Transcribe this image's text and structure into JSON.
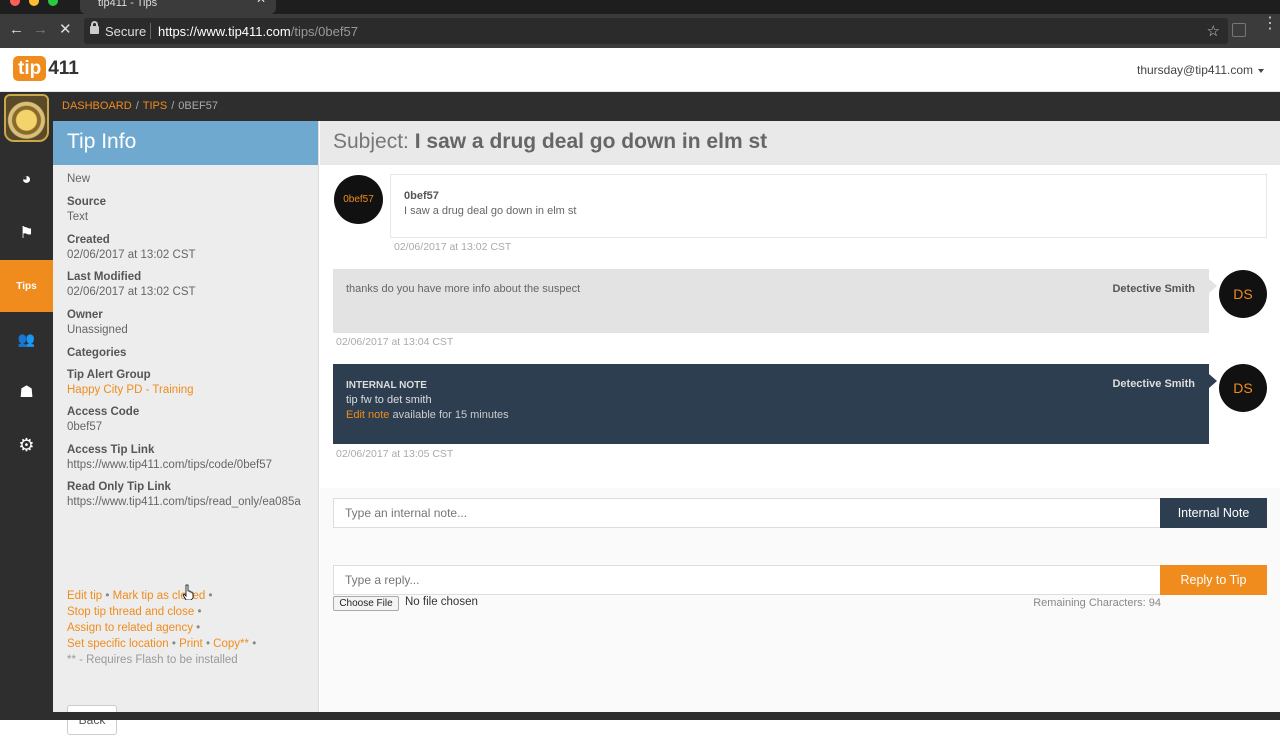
{
  "browser": {
    "tab_title": "tip411 - Tips",
    "tab_close": "✕",
    "secure_label": "Secure",
    "url_host": "https://www.tip411.com",
    "url_path": "/tips/0bef57",
    "back_glyph": "←",
    "forward_glyph": "→",
    "stop_glyph": "✕",
    "star_glyph": "☆",
    "menu_glyph": "⋮",
    "traffic_colors": [
      "#ff5f57",
      "#febc2e",
      "#28c840"
    ]
  },
  "header": {
    "logo_tip": "tip",
    "logo_num": "411",
    "user_email": "thursday@tip411.com"
  },
  "sidebar": {
    "items": [
      {
        "icon": "dashboard-icon",
        "glyph": "◕"
      },
      {
        "icon": "flag-icon",
        "glyph": "⚑"
      },
      {
        "icon": "tips-icon",
        "label": "Tips",
        "active": true
      },
      {
        "icon": "users-icon",
        "glyph": "👥"
      },
      {
        "icon": "sitemap-icon",
        "glyph": "☗"
      },
      {
        "icon": "gear-icon",
        "glyph": "⚙"
      }
    ],
    "accent": "#f08c1d"
  },
  "breadcrumb": {
    "dashboard": "DASHBOARD",
    "tips": "TIPS",
    "sep": "/",
    "current": "0BEF57"
  },
  "tip_info": {
    "title": "Tip Info",
    "status": "New",
    "source_label": "Source",
    "source_value": "Text",
    "created_label": "Created",
    "created_value": "02/06/2017 at 13:02 CST",
    "modified_label": "Last Modified",
    "modified_value": "02/06/2017 at 13:02 CST",
    "owner_label": "Owner",
    "owner_value": "Unassigned",
    "categories_label": "Categories",
    "alert_group_label": "Tip Alert Group",
    "alert_group_value": "Happy City PD - Training",
    "access_code_label": "Access Code",
    "access_code_value": "0bef57",
    "access_link_label": "Access Tip Link",
    "access_link_value": "https://www.tip411.com/tips/code/0bef57",
    "readonly_link_label": "Read Only Tip Link",
    "readonly_link_value": "https://www.tip411.com/tips/read_only/ea085a",
    "actions": {
      "edit": "Edit tip",
      "close": "Mark tip as closed",
      "stop": "Stop tip thread and close",
      "assign": "Assign to related agency",
      "location": "Set specific location",
      "print": "Print",
      "copy": "Copy**",
      "dot": "•",
      "flash_note": "** - Requires Flash to be installed"
    },
    "back_label": "Back"
  },
  "thread": {
    "subject_prefix": "Subject:",
    "subject": "I saw a drug deal go down in elm st",
    "messages": [
      {
        "avatar": "0bef57",
        "author": "0bef57",
        "text": "I saw a drug deal go down in elm st",
        "time": "02/06/2017 at 13:02 CST"
      },
      {
        "avatar": "DS",
        "author": "Detective Smith",
        "text": "thanks do you have more info about the suspect",
        "time": "02/06/2017 at 13:04 CST"
      },
      {
        "avatar": "DS",
        "author": "Detective Smith",
        "heading": "INTERNAL NOTE",
        "text": "tip fw to det smith",
        "edit_link": "Edit note",
        "edit_suffix": "available for 15 minutes",
        "time": "02/06/2017 at 13:05 CST"
      }
    ]
  },
  "forms": {
    "note_placeholder": "Type an internal note...",
    "note_button": "Internal Note",
    "reply_placeholder": "Type a reply...",
    "reply_button": "Reply to Tip",
    "file_button": "Choose File",
    "file_status": "No file chosen",
    "remaining": "Remaining Characters: 94"
  }
}
